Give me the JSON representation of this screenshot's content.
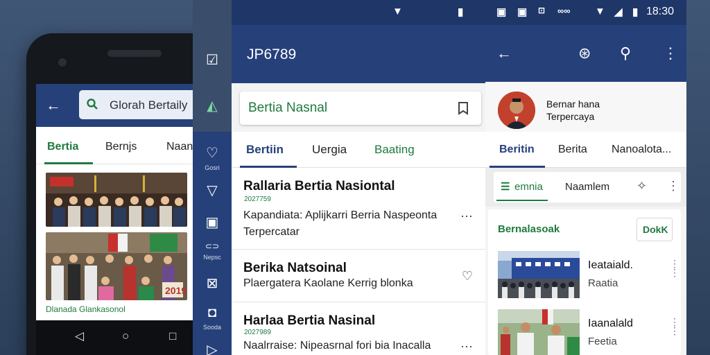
{
  "panel1": {
    "search_text": "Glorah Bertaily",
    "tabs": [
      "Bertia",
      "Bernjs",
      "Naan"
    ],
    "image2_badge": "2019",
    "caption": "Dlanada Glankasonol",
    "nav_icons": [
      "back-triangle-icon",
      "home-circle-icon",
      "recents-square-icon"
    ]
  },
  "rail": {
    "items": [
      {
        "label": "Gosri"
      },
      {
        "label": ""
      },
      {
        "label": ""
      },
      {
        "label": "Nepsc"
      },
      {
        "label": ""
      },
      {
        "label": "Sooda"
      }
    ]
  },
  "panel2": {
    "app_title": "JP6789",
    "search_text": "Bertia Nasnal",
    "tabs": [
      "Bertiin",
      "Uergia",
      "Baating"
    ],
    "articles": [
      {
        "title": "Rallaria Bertia Nasiontal",
        "id": "2027759",
        "body": "Kapandiata: Aplijkarri Berria Naspeonta",
        "body2": "Terpercatar",
        "action": "⋯"
      },
      {
        "title": "Berika Natsoinal",
        "id": "",
        "body": "Plaergatera Kaolane Kerrig blonka",
        "body2": "",
        "action": "♡"
      },
      {
        "title": "Harlaa Bertia Nasinal",
        "id": "2027989",
        "body": "Naalrraise: Nipeasrnal fori bia Inacalla",
        "body2": "",
        "action": "⋯"
      }
    ]
  },
  "panel3": {
    "status_time": "18:30",
    "profile_line1": "Bernar hana",
    "profile_line2": "Terpercaya",
    "tabs": [
      "Beritin",
      "Berita",
      "Nanoalota..."
    ],
    "chip_active": "emnia",
    "chip_other": "Naamlem",
    "section_title": "Bernalasoak",
    "section_button": "DokK",
    "items": [
      {
        "title": "Ieataiald.",
        "subtitle": "Raatia"
      },
      {
        "title": "Iaanalald",
        "subtitle": "Feetia"
      }
    ]
  },
  "colors": {
    "primary": "#26407a",
    "accent_green": "#1f7a3f",
    "background": "#3f5675"
  }
}
